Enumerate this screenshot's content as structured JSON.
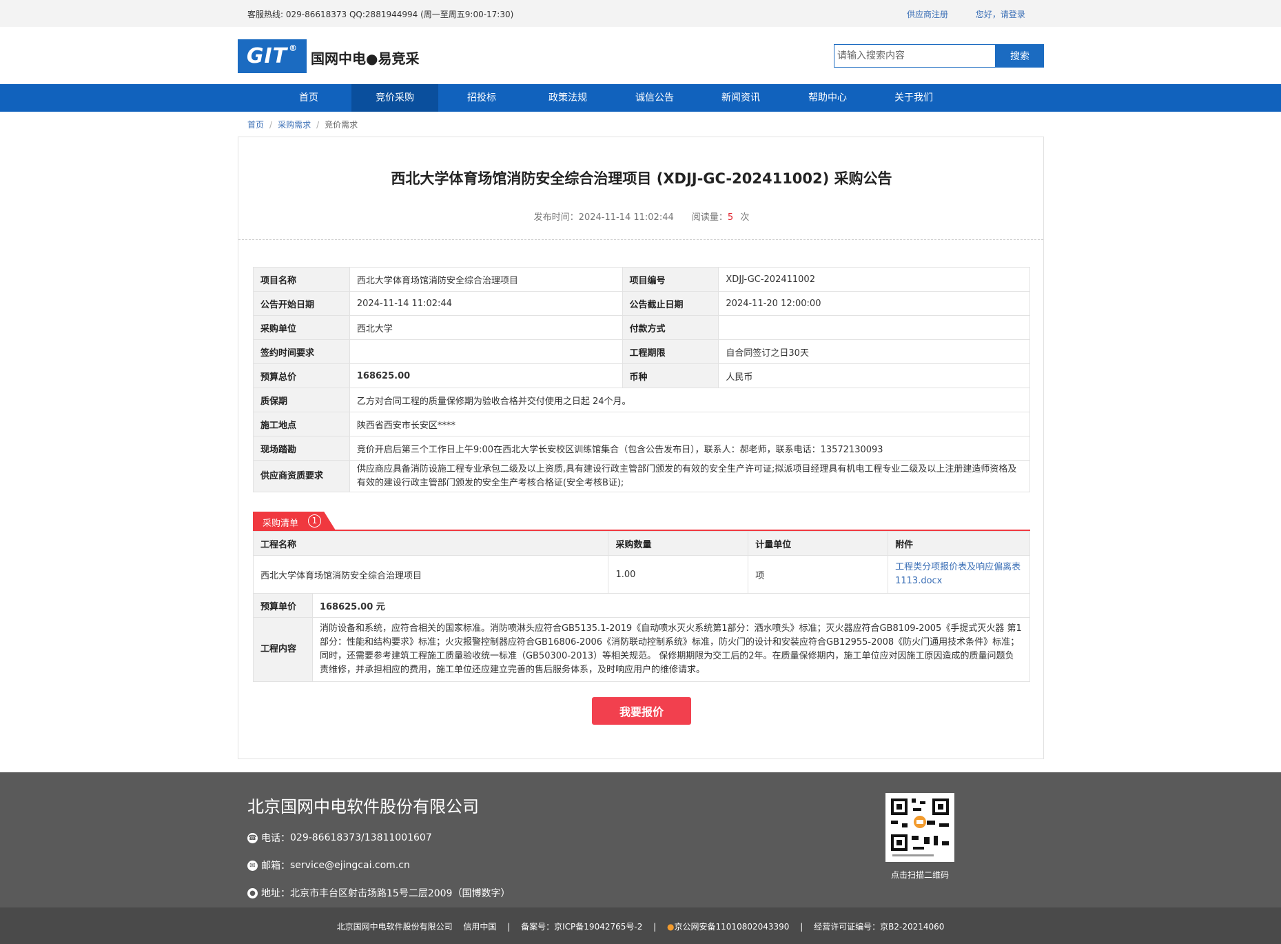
{
  "topbar": {
    "hotline": "客服热线: 029-86618373 QQ:2881944994 (周一至周五9:00-17:30)",
    "supplier_register": "供应商注册",
    "login": "您好，请登录"
  },
  "header": {
    "logo_mark": "GIT",
    "logo_reg": "®",
    "logo_text": "国网中电●易竞采",
    "search_placeholder": "请输入搜索内容",
    "search_button": "搜索"
  },
  "nav": {
    "items": [
      "首页",
      "竞价采购",
      "招投标",
      "政策法规",
      "诚信公告",
      "新闻资讯",
      "帮助中心",
      "关于我们"
    ],
    "active": "竞价采购"
  },
  "breadcrumb": {
    "home": "首页",
    "level2": "采购需求",
    "current": "竞价需求",
    "sep": "/"
  },
  "notice": {
    "title": "西北大学体育场馆消防安全综合治理项目 (XDJJ-GC-202411002) 采购公告",
    "publish_label": "发布时间：",
    "publish_time": "2024-11-14 11:02:44",
    "views_label": "阅读量：",
    "views": "5",
    "views_unit": "次"
  },
  "info": {
    "project_name_label": "项目名称",
    "project_name": "西北大学体育场馆消防安全综合治理项目",
    "project_no_label": "项目编号",
    "project_no": "XDJJ-GC-202411002",
    "start_label": "公告开始日期",
    "start": "2024-11-14 11:02:44",
    "end_label": "公告截止日期",
    "end": "2024-11-20 12:00:00",
    "buyer_label": "采购单位",
    "buyer": "西北大学",
    "payment_label": "付款方式",
    "payment": "",
    "sign_label": "签约时间要求",
    "sign": "",
    "period_label": "工程期限",
    "period": "自合同签订之日30天",
    "budget_label": "预算总价",
    "budget": "168625.00",
    "currency_label": "币种",
    "currency": "人民币",
    "warranty_label": "质保期",
    "warranty": "乙方对合同工程的质量保修期为验收合格并交付使用之日起 24个月。",
    "site_label": "施工地点",
    "site": "陕西省西安市长安区****",
    "survey_label": "现场踏勘",
    "survey": "竞价开启后第三个工作日上午9:00在西北大学长安校区训练馆集合（包含公告发布日），联系人：郝老师，联系电话：13572130093",
    "qual_label": "供应商资质要求",
    "qual": "供应商应具备消防设施工程专业承包二级及以上资质,具有建设行政主管部门颁发的有效的安全生产许可证;拟派项目经理具有机电工程专业二级及以上注册建造师资格及有效的建设行政主管部门颁发的安全生产考核合格证(安全考核B证);"
  },
  "list": {
    "tab_label": "采购清单",
    "tab_count": "1",
    "headers": [
      "工程名称",
      "采购数量",
      "计量单位",
      "附件"
    ],
    "row": {
      "name": "西北大学体育场馆消防安全综合治理项目",
      "qty": "1.00",
      "unit": "项",
      "attachment": "工程类分项报价表及响应偏离表1113.docx"
    },
    "unit_price_label": "预算单价",
    "unit_price": "168625.00 元",
    "content_label": "工程内容",
    "content": "消防设备和系统，应符合相关的国家标准。消防喷淋头应符合GB5135.1-2019《自动喷水灭火系统第1部分：洒水喷头》标准；灭火器应符合GB8109-2005《手提式灭火器 第1部分：性能和结构要求》标准；火灾报警控制器应符合GB16806-2006《消防联动控制系统》标准，防火门的设计和安装应符合GB12955-2008《防火门通用技术条件》标准；同时，还需要参考建筑工程施工质量验收统一标准（GB50300-2013）等相关规范。 保修期期限为交工后的2年。在质量保修期内，施工单位应对因施工原因造成的质量问题负责维修，并承担相应的费用，施工单位还应建立完善的售后服务体系，及时响应用户的维修请求。"
  },
  "quote_button": "我要报价",
  "footer": {
    "company": "北京国网中电软件股份有限公司",
    "phone_label": "电话：",
    "phone": "029-86618373/13811001607",
    "email_label": "邮箱：",
    "email": "service@ejingcai.com.cn",
    "address_label": "地址：",
    "address": "北京市丰台区射击场路15号二层2009（国博数字）",
    "qr_label": "点击扫描二维码"
  },
  "bottombar": {
    "company": "北京国网中电软件股份有限公司",
    "credit": "信用中国",
    "icp": "备案号：京ICP备19042765号-2",
    "police": "京公网安备11010802043390",
    "license": "经营许可证编号：京B2-20214060",
    "sep": "|"
  },
  "colors": {
    "brand_blue": "#1162bd",
    "accent_red": "#f0383f",
    "footer_gray": "#5a5a5a"
  }
}
